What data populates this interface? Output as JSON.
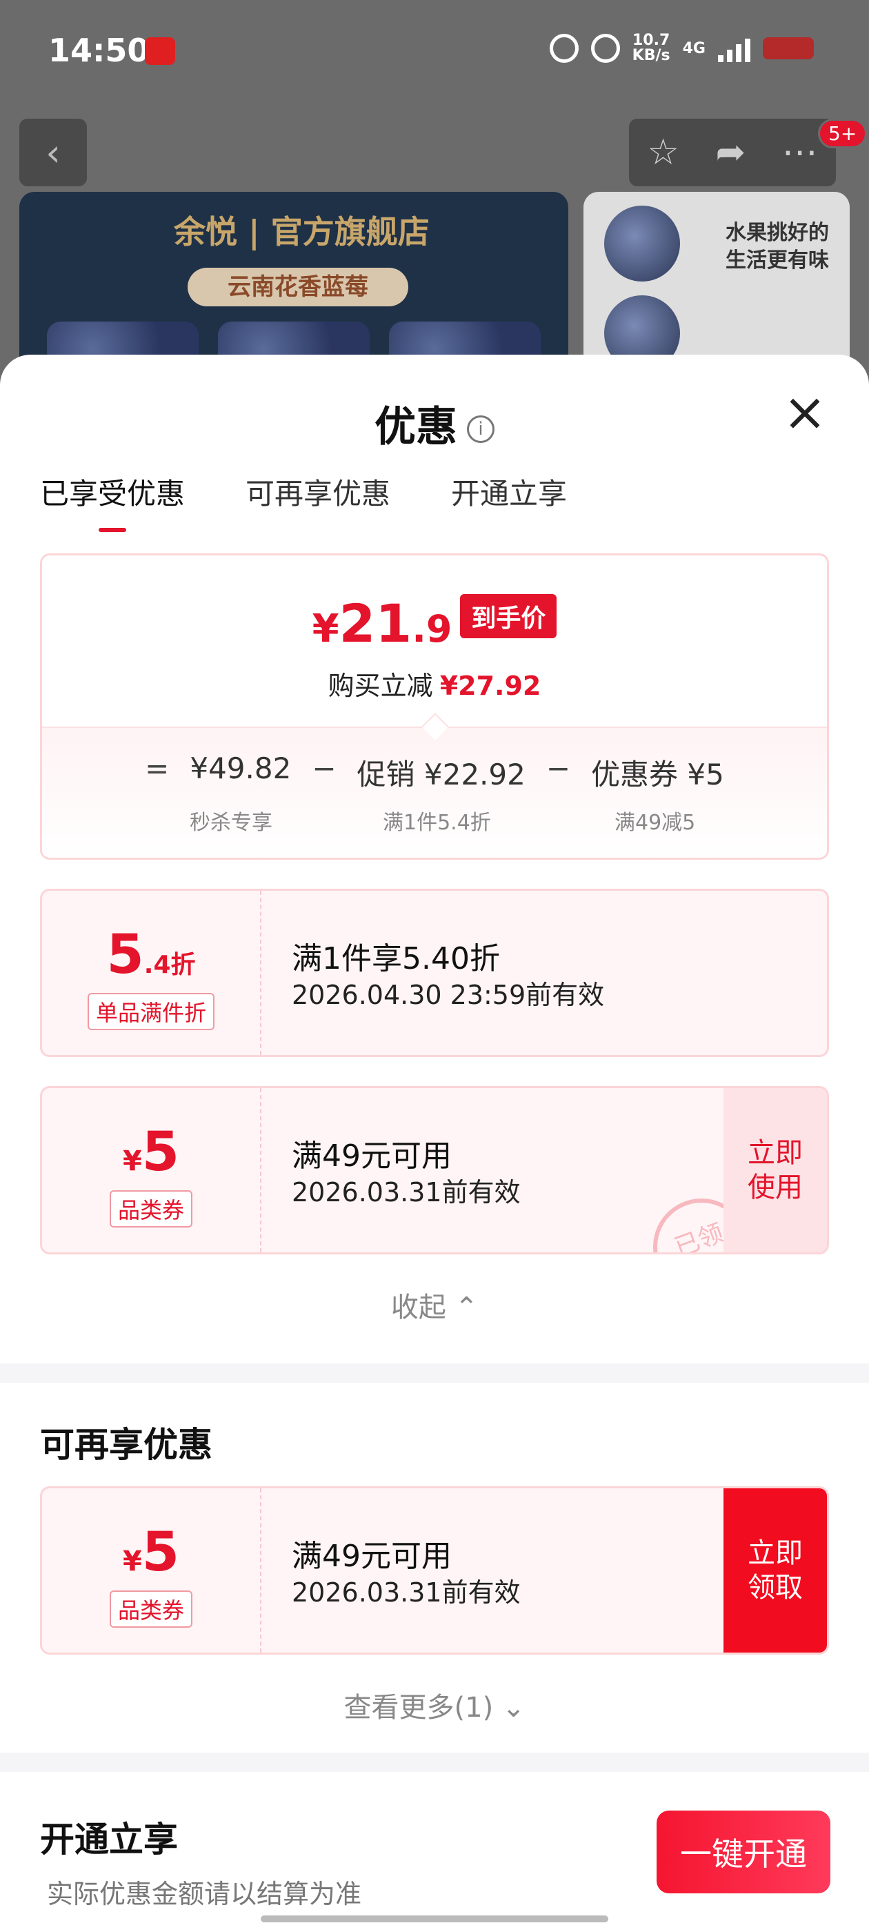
{
  "status_bar": {
    "time": "14:50",
    "net_speed_value": "10.7",
    "net_speed_unit": "KB/s",
    "network": "4G"
  },
  "header_bg": {
    "badge": "5+",
    "store_name": "余悦 | 官方旗舰店",
    "product_ribbon": "云南花香蓝莓",
    "side_text_1": "水果挑好的",
    "side_text_2": "生活更有味"
  },
  "sheet": {
    "title": "优惠",
    "tabs": [
      "已享受优惠",
      "可再享优惠",
      "开通立享"
    ],
    "active_tab": 0
  },
  "summary": {
    "final_currency": "¥",
    "final_int": "21",
    "final_dec": ".9",
    "final_tag": "到手价",
    "reduce_label": "购买立减",
    "reduce_value": "¥27.92",
    "eq": "=",
    "base_price": "¥49.82",
    "base_label": "秒杀专享",
    "minus1": "−",
    "promo": "促销 ¥22.92",
    "promo_label": "满1件5.4折",
    "minus2": "−",
    "coupon": "优惠券 ¥5",
    "coupon_label": "满49减5"
  },
  "discount_card": {
    "value_int": "5",
    "value_dec": ".4",
    "value_unit": "折",
    "label": "单品满件折",
    "title": "满1件享5.40折",
    "validity": "2026.04.30 23:59前有效"
  },
  "used_coupon": {
    "currency": "¥",
    "value": "5",
    "label": "品类券",
    "title": "满49元可用",
    "validity": "2026.03.31前有效",
    "action": "立即\n使用",
    "stamp": "已领"
  },
  "collapse_label": "收起 ⌃",
  "more_section": {
    "title": "可再享优惠",
    "coupon": {
      "currency": "¥",
      "value": "5",
      "label": "品类券",
      "title": "满49元可用",
      "validity": "2026.03.31前有效",
      "action": "立即\n领取"
    },
    "more_label": "查看更多(1) ⌄"
  },
  "open_section": {
    "title": "开通立享",
    "note": "实际优惠金额请以结算为准",
    "button": "一键开通"
  },
  "colors": {
    "accent": "#e3142b",
    "card_border": "#fbd5d8",
    "card_bg": "#fff5f6"
  }
}
